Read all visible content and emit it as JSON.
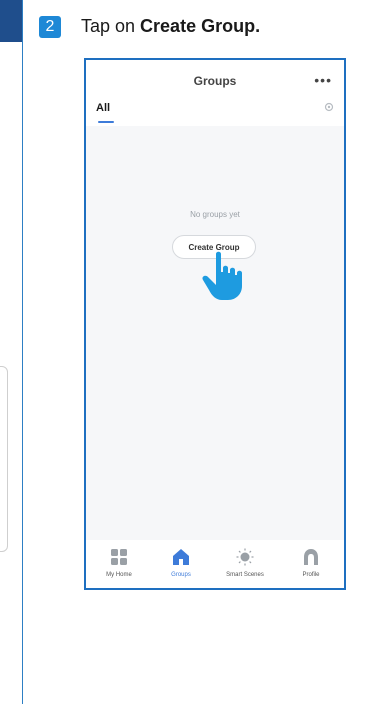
{
  "instruction": {
    "step_number": "2",
    "text_prefix": "Tap on ",
    "text_bold": "Create Group."
  },
  "app": {
    "title": "Groups",
    "more_icon": "more-horizontal-icon",
    "tabs": [
      {
        "label": "All",
        "active": true
      }
    ],
    "settings_icon": "gear-icon",
    "empty_state": {
      "message": "No groups yet",
      "button_label": "Create Group"
    },
    "bottom_nav": [
      {
        "label": "My Home",
        "icon": "grid-icon",
        "active": false
      },
      {
        "label": "Groups",
        "icon": "home-icon",
        "active": true
      },
      {
        "label": "Smart Scenes",
        "icon": "sun-icon",
        "active": false
      },
      {
        "label": "Profile",
        "icon": "user-icon",
        "active": false
      }
    ]
  },
  "colors": {
    "accent": "#3d7bd9",
    "step_badge": "#1e88d6",
    "phone_border": "#1e6fc0",
    "hand": "#1e9be0"
  }
}
